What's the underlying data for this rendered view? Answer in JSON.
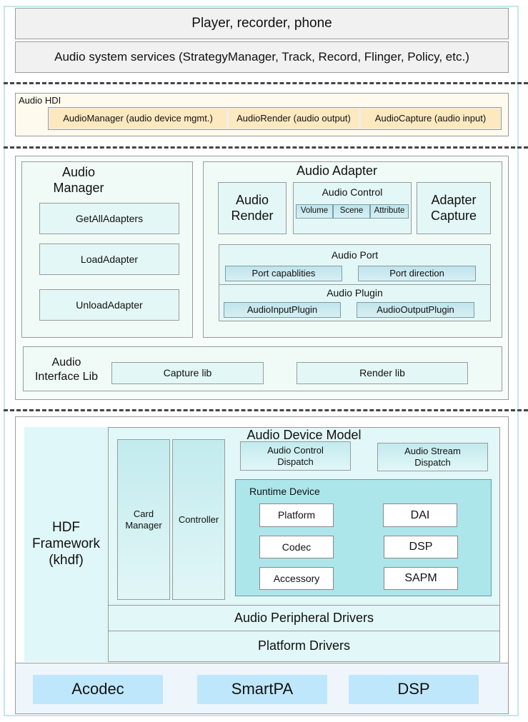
{
  "layers": {
    "apps": "Player, recorder, phone",
    "services": "Audio system services (StrategyManager, Track, Record, Flinger, Policy, etc.)"
  },
  "hdi": {
    "title": "Audio HDI",
    "items": [
      "AudioManager (audio device mgmt.)",
      "AudioRender (audio output)",
      "AudioCapture (audio input)"
    ]
  },
  "audio_manager": {
    "title": "Audio Manager",
    "items": [
      "GetAllAdapters",
      "LoadAdapter",
      "UnloadAdapter"
    ]
  },
  "audio_adapter": {
    "title": "Audio Adapter",
    "render": "Audio Render",
    "control": {
      "title": "Audio Control",
      "items": [
        "Volume",
        "Scene",
        "Attribute"
      ]
    },
    "capture": "Adapter Capture",
    "port": {
      "title": "Audio Port",
      "items": [
        "Port capablities",
        "Port direction"
      ]
    },
    "plugin": {
      "title": "Audio Plugin",
      "items": [
        "AudioInputPlugin",
        "AudioOutputPlugin"
      ]
    }
  },
  "interface_lib": {
    "title": "Audio Interface Lib",
    "items": [
      "Capture lib",
      "Render lib"
    ]
  },
  "hdf": {
    "title": "HDF Framework (khdf)"
  },
  "device_model": {
    "title": "Audio Device Model",
    "card_manager": "Card Manager",
    "controller": "Controller",
    "control_dispatch": "Audio Control Dispatch",
    "stream_dispatch": "Audio Stream Dispatch",
    "runtime": {
      "title": "Runtime Device",
      "items": [
        "Platform",
        "DAI",
        "Codec",
        "DSP",
        "Accessory",
        "SAPM"
      ]
    }
  },
  "drivers": {
    "peripheral": "Audio Peripheral Drivers",
    "platform": "Platform Drivers"
  },
  "hardware": [
    "Acodec",
    "SmartPA",
    "DSP"
  ]
}
